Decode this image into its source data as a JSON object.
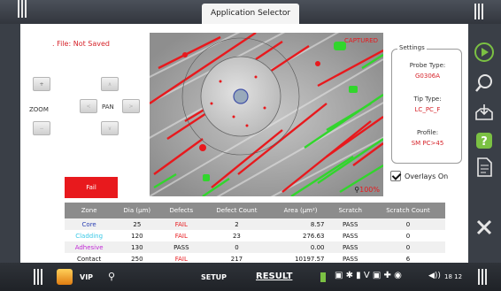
{
  "header": {
    "title": "Application Selector"
  },
  "file_status": ". File: Not Saved",
  "zoom": {
    "label": "ZOOM",
    "in_symbol": "+",
    "out_symbol": "−",
    "level": "100%"
  },
  "pan": {
    "label": "PAN",
    "up": "∧",
    "left": "<",
    "right": ">",
    "down": "∨"
  },
  "result_badge": "Fail",
  "image": {
    "status": "CAPTURED"
  },
  "settings": {
    "legend": "Settings",
    "probe_type_label": "Probe Type:",
    "probe_type": "G0306A",
    "tip_type_label": "Tip Type:",
    "tip_type": "LC_PC_F",
    "profile_label": "Profile:",
    "profile": "SM PC>45"
  },
  "overlays": {
    "label": "Overlays On",
    "checked": true
  },
  "table": {
    "headers": [
      "Zone",
      "Dia (µm)",
      "Defects",
      "Defect Count",
      "Area (µm²)",
      "Scratch",
      "Scratch Count"
    ],
    "rows": [
      {
        "zone": "Core",
        "dia": "25",
        "defects": "FAIL",
        "defect_count": "2",
        "area": "8.57",
        "scratch": "PASS",
        "scratch_count": "0"
      },
      {
        "zone": "Cladding",
        "dia": "120",
        "defects": "FAIL",
        "defect_count": "23",
        "area": "276.63",
        "scratch": "PASS",
        "scratch_count": "0"
      },
      {
        "zone": "Adhesive",
        "dia": "130",
        "defects": "PASS",
        "defect_count": "0",
        "area": "0.00",
        "scratch": "PASS",
        "scratch_count": "0"
      },
      {
        "zone": "Contact",
        "dia": "250",
        "defects": "FAIL",
        "defect_count": "217",
        "area": "10197.57",
        "scratch": "PASS",
        "scratch_count": "6"
      }
    ]
  },
  "bottom": {
    "vip": "VIP",
    "setup": "SETUP",
    "result": "RESULT",
    "time": "18 12"
  },
  "colors": {
    "fail": "#e8191d",
    "pass_text": "#111111",
    "core": "#2a3fb3",
    "cladding": "#38c8e6",
    "adhesive": "#c12ad6",
    "contact": "#111111",
    "accent_green": "#7bc143"
  },
  "icons": [
    "play-icon",
    "magnify-icon",
    "save-tray-icon",
    "help-icon",
    "report-icon",
    "close-icon",
    "search-icon",
    "battery-icon",
    "bluetooth-icon",
    "wifi-icon",
    "volume-icon"
  ]
}
